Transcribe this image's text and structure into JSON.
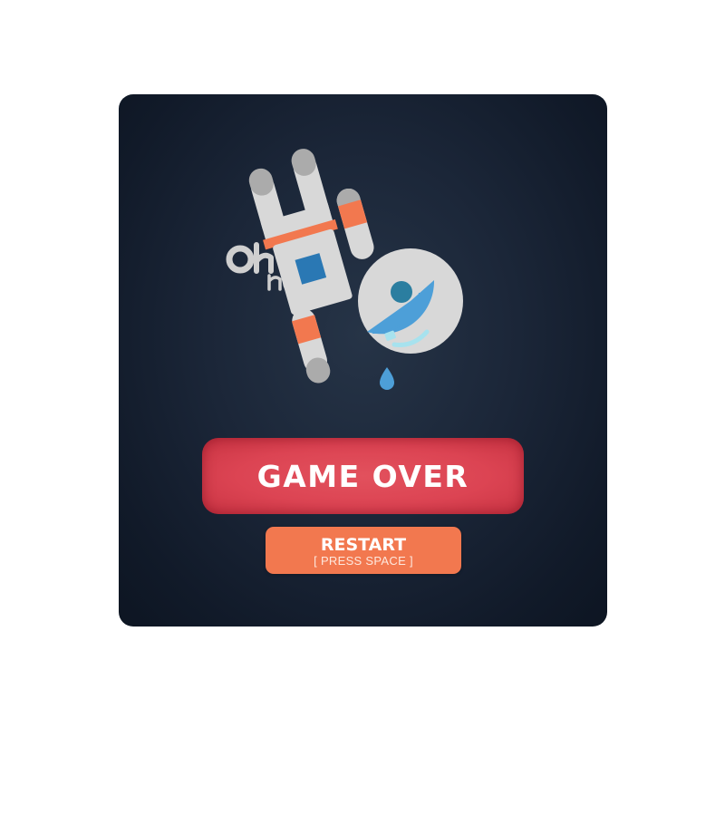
{
  "dialog": {
    "exclamation": "Oh no!",
    "title": "GAME OVER",
    "restart_label": "RESTART",
    "restart_hint": "[ PRESS SPACE ]"
  },
  "colors": {
    "panel_background": "#1b2638",
    "banner_red": "#dc4453",
    "button_orange": "#f2784f",
    "suit_gray": "#d8d8d8",
    "visor_blue": "#4d9fd8"
  },
  "icons": {
    "character": "upside-down-astronaut",
    "tear": "teardrop"
  }
}
